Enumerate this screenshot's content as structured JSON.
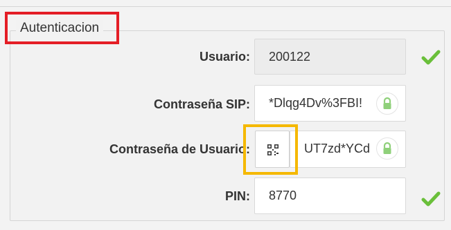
{
  "section": {
    "legend": "Autenticacion"
  },
  "fields": {
    "usuario": {
      "label": "Usuario:",
      "value": "200122"
    },
    "sip_password": {
      "label": "Contraseña SIP:",
      "value": "*Dlqg4Dv%3FBI!"
    },
    "user_password": {
      "label": "Contraseña de Usuario:",
      "value": "UT7zd*YCd"
    },
    "pin": {
      "label": "PIN:",
      "value": "8770"
    }
  },
  "icons": {
    "check": "check-icon",
    "lock": "lock-icon",
    "qr": "qr-code-icon"
  },
  "colors": {
    "check": "#6abf3a",
    "lock": "#8fd07a",
    "legend_highlight": "#e41e26",
    "qr_highlight": "#f5b800"
  }
}
